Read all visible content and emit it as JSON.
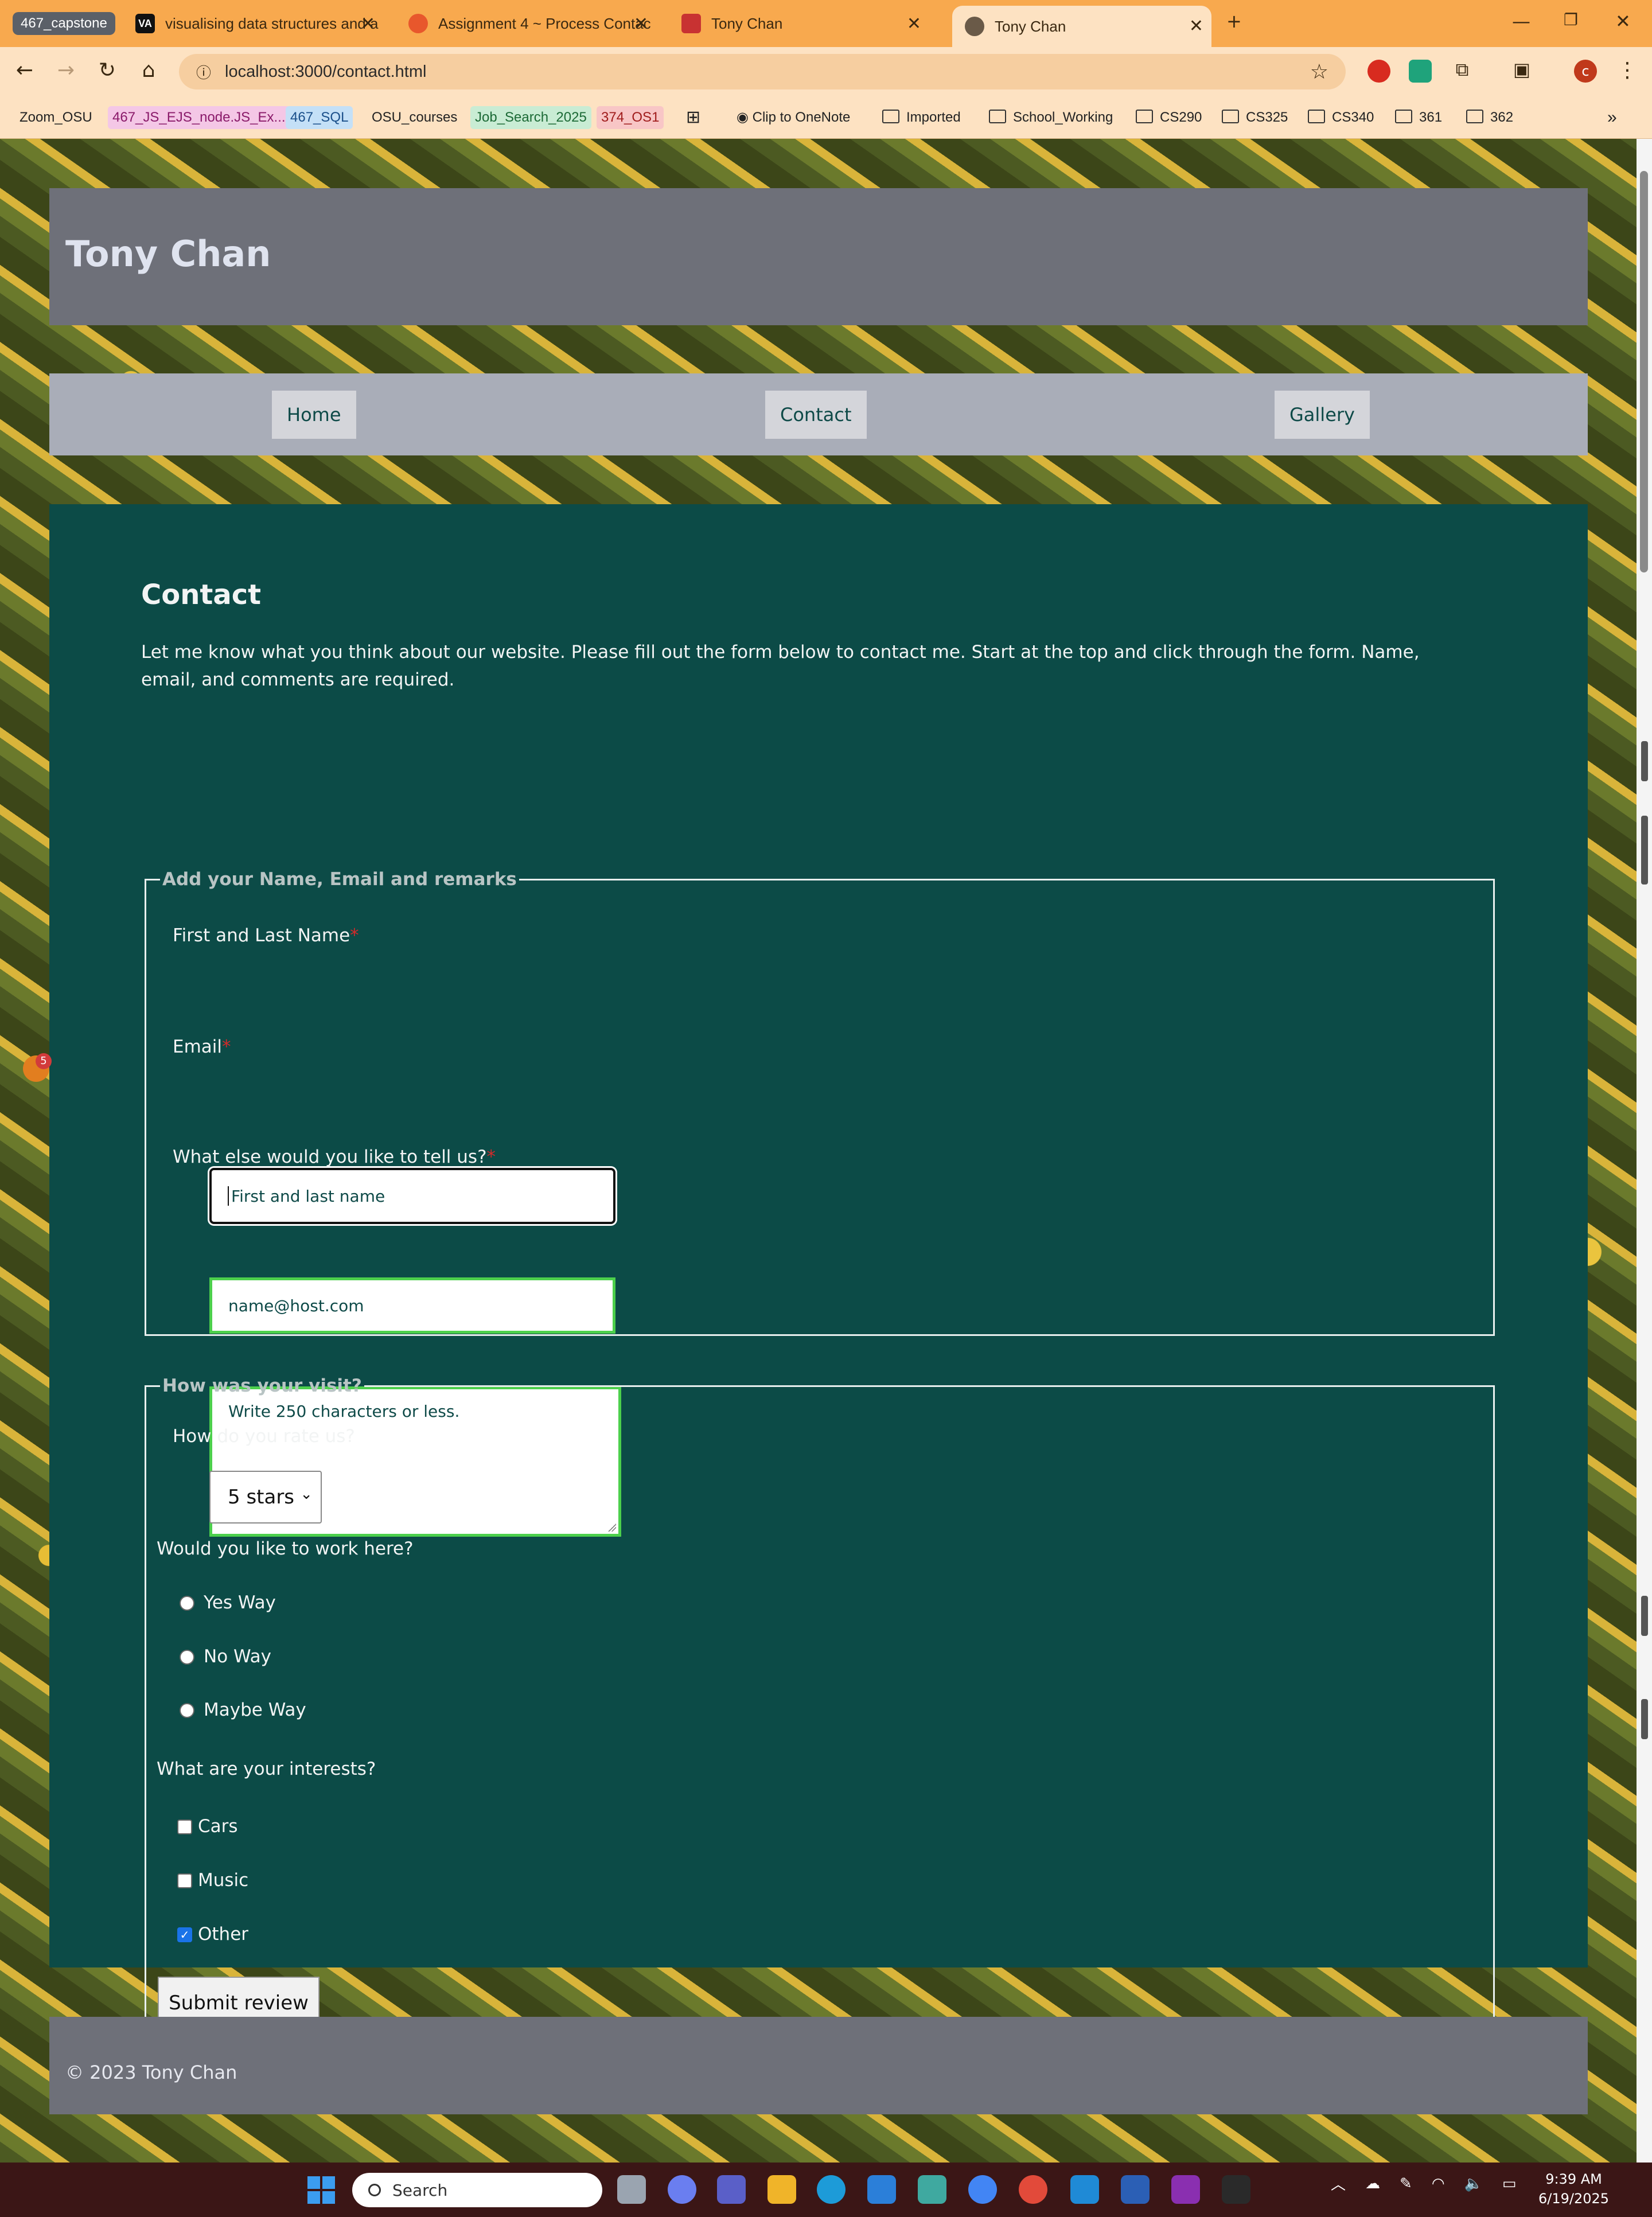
{
  "browser": {
    "tabs": [
      {
        "label": "467_capstone",
        "kind": "group"
      },
      {
        "label": "visualising data structures and a"
      },
      {
        "label": "Assignment 4 ~ Process Contac"
      },
      {
        "label": "Tony Chan"
      },
      {
        "label": "Tony Chan",
        "active": true
      }
    ],
    "url": "localhost:3000/contact.html",
    "profile_initial": "c",
    "bookmarks": [
      "Zoom_OSU",
      "467_JS_EJS_node.JS_Ex...",
      "467_SQL",
      "OSU_courses",
      "Job_Search_2025",
      "374_OS1",
      "Clip to OneNote",
      "Imported",
      "School_Working",
      "CS290",
      "CS325",
      "CS340",
      "361",
      "362"
    ],
    "more_bookmarks": "»"
  },
  "site": {
    "title": "Tony Chan",
    "nav": [
      "Home",
      "Contact",
      "Gallery"
    ],
    "footer": "© 2023 Tony Chan"
  },
  "contact": {
    "heading": "Contact",
    "intro": "Let me know what you think about our website. Please fill out the form below to contact me. Start at the top and click through the form. Name, email, and comments are required.",
    "fieldset1": {
      "legend": "Add your Name, Email and remarks",
      "name_label": "First and Last Name",
      "name_placeholder": "First and last name",
      "email_label": "Email",
      "email_placeholder": "name@host.com",
      "comments_label": "What else would you like to tell us?",
      "comments_placeholder": "Write 250 characters or less.",
      "required_mark": "*"
    },
    "fieldset2": {
      "legend": "How was your visit?",
      "rating_label": "How do you rate us?",
      "rating_value": "5 stars",
      "work_label": "Would you like to work here?",
      "work_options": [
        "Yes Way",
        "No Way",
        "Maybe Way"
      ],
      "interests_label": "What are your interests?",
      "interests": [
        {
          "label": "Cars",
          "checked": false
        },
        {
          "label": "Music",
          "checked": false
        },
        {
          "label": "Other",
          "checked": true
        }
      ],
      "submit_label": "Submit review"
    }
  },
  "taskbar": {
    "search_placeholder": "Search",
    "time": "9:39 AM",
    "date": "6/19/2025",
    "weather_badge": "5"
  }
}
